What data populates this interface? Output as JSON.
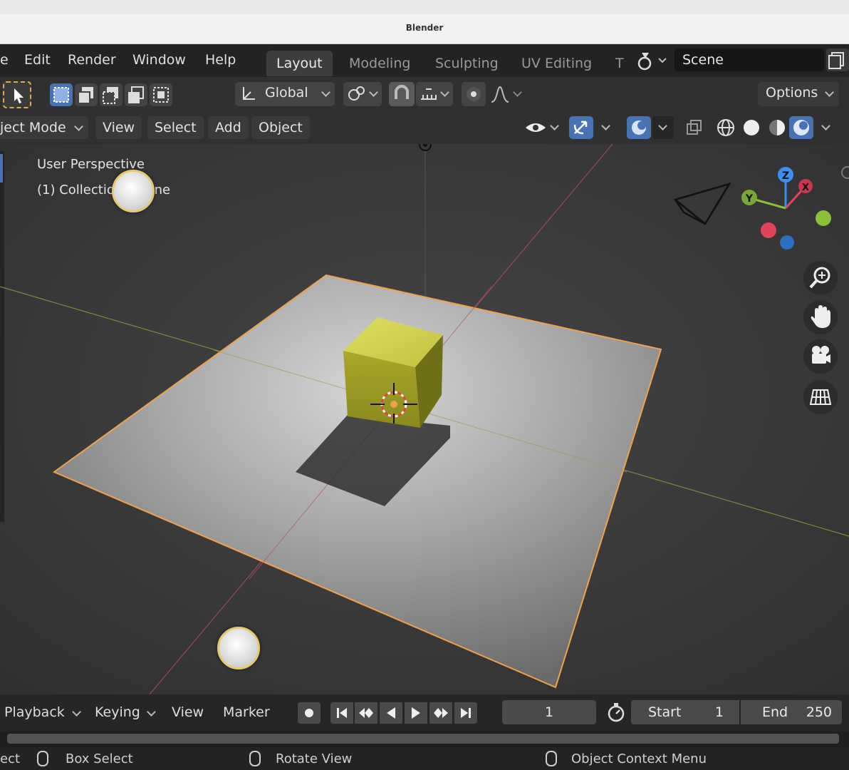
{
  "window": {
    "title": "Blender"
  },
  "menu": {
    "items": [
      {
        "label": "e"
      },
      {
        "label": "Edit"
      },
      {
        "label": "Render"
      },
      {
        "label": "Window"
      },
      {
        "label": "Help"
      }
    ]
  },
  "workspaces": {
    "tabs": [
      {
        "label": "Layout",
        "active": true
      },
      {
        "label": "Modeling"
      },
      {
        "label": "Sculpting"
      },
      {
        "label": "UV Editing"
      },
      {
        "label": "T"
      }
    ]
  },
  "scene": {
    "name": "Scene"
  },
  "tool_header": {
    "orientation": "Global",
    "options_label": "Options"
  },
  "viewport_header": {
    "mode": "ject Mode",
    "view": "View",
    "select": "Select",
    "add": "Add",
    "object": "Object"
  },
  "viewport": {
    "perspective": "User Perspective",
    "collection": "(1) Collection | Plane",
    "gizmo_axes": {
      "x": "X",
      "y": "Y",
      "z": "Z"
    }
  },
  "timeline": {
    "playback": "Playback",
    "keying": "Keying",
    "view": "View",
    "marker": "Marker",
    "current_frame": "1",
    "start_label": "Start",
    "start_value": "1",
    "end_label": "End",
    "end_value": "250"
  },
  "statusbar": {
    "left_action": "ect",
    "box_select": "Box Select",
    "rotate_view": "Rotate View",
    "context_menu": "Object Context Menu"
  },
  "icons": [
    "select-cursor-icon",
    "box-select-icon",
    "global-orientation-icon",
    "snap-icon",
    "proportional-edit-icon",
    "eye-icon",
    "gizmo-icon",
    "overlay-icon",
    "xray-icon",
    "wireframe-shading-icon",
    "solid-shading-icon",
    "material-shading-icon",
    "rendered-shading-icon",
    "zoom-icon",
    "hand-pan-icon",
    "camera-view-icon",
    "grid-ortho-icon",
    "play-icon",
    "record-icon",
    "stopwatch-icon",
    "mouse-icon"
  ],
  "colors": {
    "accent": "#4772b3",
    "selection_outline": "#f0a24a",
    "cube": "#b5b52c",
    "x_axis": "#e0435a",
    "y_axis": "#8ac03a",
    "z_axis": "#3b8ff0"
  }
}
